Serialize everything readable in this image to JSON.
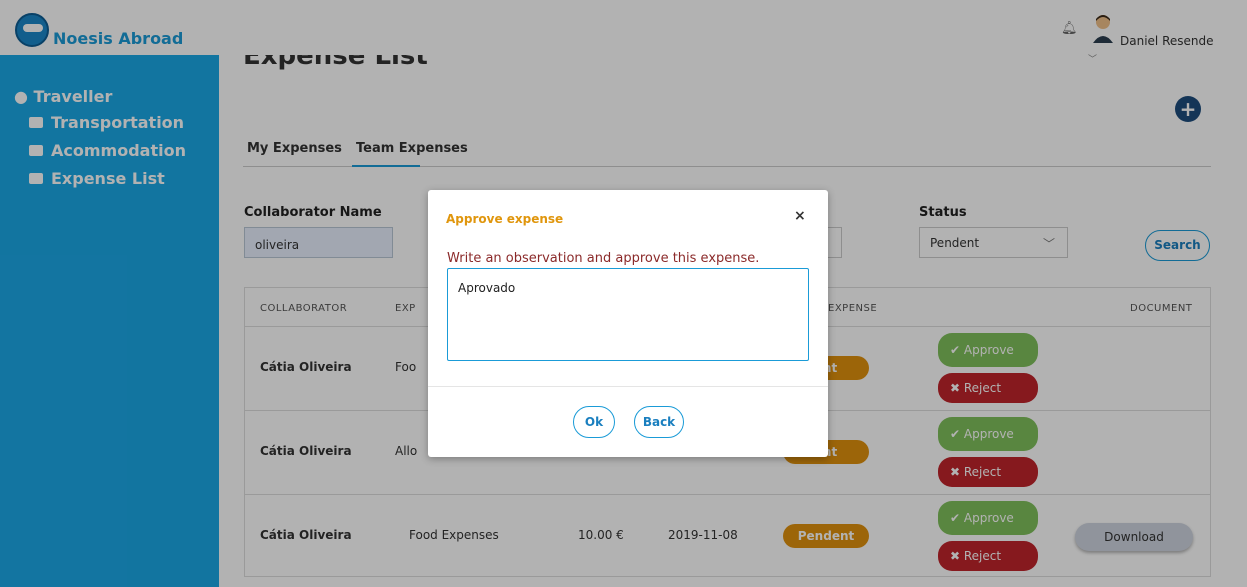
{
  "app": {
    "name": "Noesis Abroad",
    "user": "Daniel Resende"
  },
  "sidebar": {
    "section": "Traveller",
    "items": [
      {
        "label": "Transportation",
        "icon": "suitcase-icon"
      },
      {
        "label": "Acommodation",
        "icon": "bed-icon"
      },
      {
        "label": "Expense List",
        "icon": "money-icon"
      }
    ]
  },
  "page": {
    "title": "Expense List"
  },
  "tabs": [
    {
      "label": "My Expenses"
    },
    {
      "label": "Team Expenses",
      "active": true
    }
  ],
  "filters": {
    "collaborator_label": "Collaborator Name",
    "collaborator_value": "oliveira",
    "status_label": "Status",
    "status_value": "Pendent",
    "search_label": "Search"
  },
  "table": {
    "headers": [
      "COLLABORATOR",
      "EXP",
      "EXPENSE",
      "DOCUMENT"
    ],
    "rows": [
      {
        "collaborator": "Cátia Oliveira",
        "type": "Foo",
        "amount": "",
        "date": "",
        "status": "ent",
        "approve": "Approve",
        "reject": "Reject",
        "document": ""
      },
      {
        "collaborator": "Cátia Oliveira",
        "type": "Allo",
        "amount": "",
        "date": "",
        "status": "ent",
        "approve": "Approve",
        "reject": "Reject",
        "document": ""
      },
      {
        "collaborator": "Cátia Oliveira",
        "type": "Food Expenses",
        "amount": "10.00 €",
        "date": "2019-11-08",
        "status": "Pendent",
        "approve": "Approve",
        "reject": "Reject",
        "document": "Download"
      }
    ]
  },
  "modal": {
    "title": "Approve expense",
    "close": "×",
    "text": "Write an observation and approve this expense.",
    "textarea_value": "Aprovado",
    "ok_label": "Ok",
    "back_label": "Back"
  },
  "colors": {
    "sidebar": "#1ba8e6",
    "accent": "#1a9bd7",
    "approve": "#80c15c",
    "reject": "#c0252b",
    "pending": "#e0910d"
  }
}
